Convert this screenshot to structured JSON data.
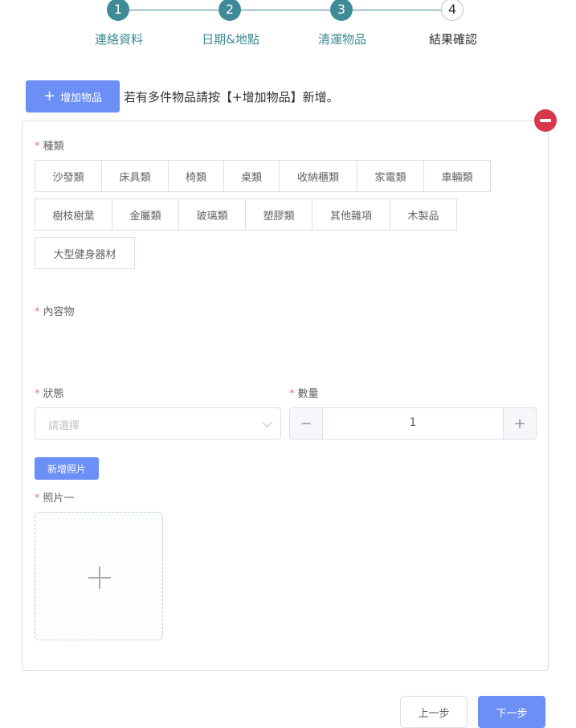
{
  "stepper": {
    "steps": [
      {
        "number": "1",
        "label": "連絡資料"
      },
      {
        "number": "2",
        "label": "日期&地點"
      },
      {
        "number": "3",
        "label": "清運物品"
      },
      {
        "number": "4",
        "label": "結果確認"
      }
    ]
  },
  "toolbar": {
    "add_item_label": "增加物品",
    "hint": "若有多件物品請按【+增加物品】新增。"
  },
  "item": {
    "category": {
      "required_mark": "*",
      "label": "種類",
      "options": [
        "沙發類",
        "床具類",
        "椅類",
        "桌類",
        "收納櫃類",
        "家電類",
        "車輛類",
        "樹枝樹葉",
        "金屬類",
        "玻璃類",
        "塑膠類",
        "其他雜項",
        "木製品",
        "大型健身器材"
      ]
    },
    "content": {
      "required_mark": "*",
      "label": "內容物"
    },
    "status": {
      "required_mark": "*",
      "label": "狀態",
      "placeholder": "請選擇"
    },
    "quantity": {
      "required_mark": "*",
      "label": "數量",
      "value": "1",
      "minus": "−",
      "plus": "+"
    },
    "add_photo_label": "新增照片",
    "photo1": {
      "required_mark": "*",
      "label": "照片一"
    }
  },
  "footer": {
    "prev_label": "上一步",
    "next_label": "下一步"
  },
  "colors": {
    "primary": "#6b8ff5",
    "step_done": "#3f8a97",
    "danger": "#d9364c",
    "required": "#f56c6c"
  }
}
